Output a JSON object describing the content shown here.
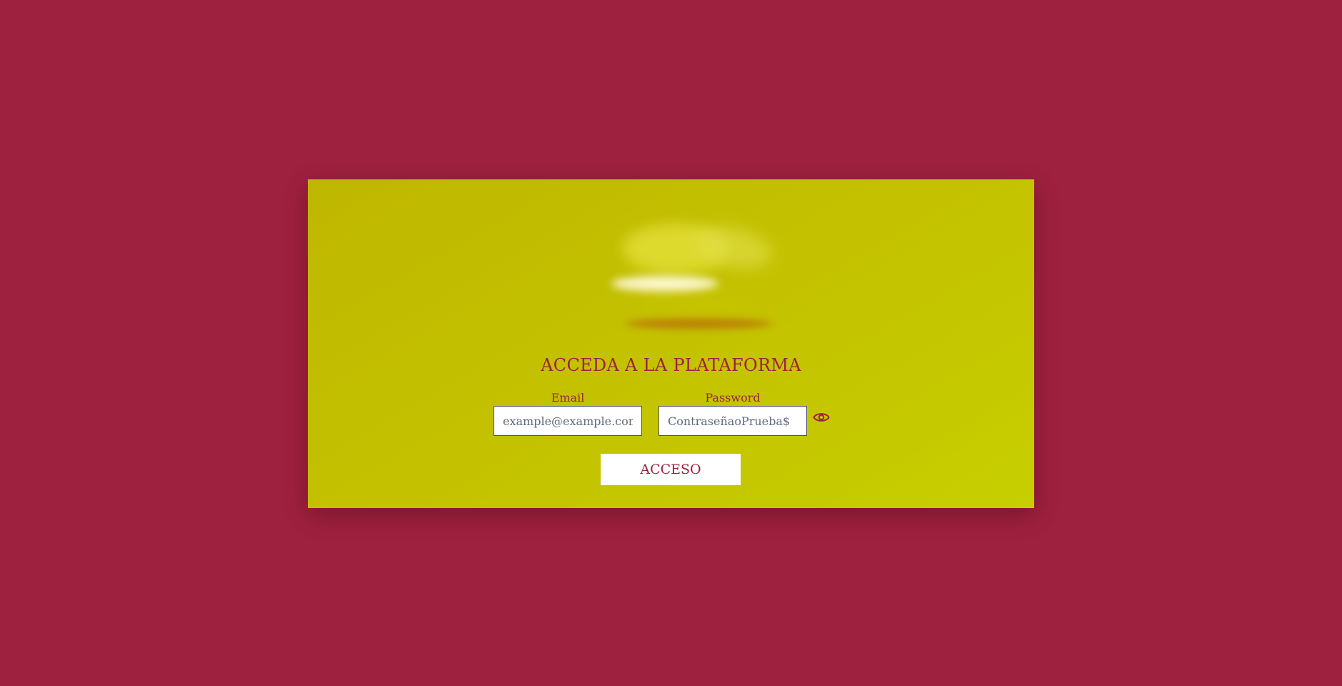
{
  "login": {
    "title": "ACCEDA A LA PLATAFORMA",
    "email_label": "Email",
    "email_placeholder": "example@example.com",
    "email_value": "",
    "password_label": "Password",
    "password_placeholder": "ContraseñaoPrueba$",
    "password_value": "",
    "toggle_icon": "eye-icon",
    "submit_label": "ACCESO"
  },
  "colors": {
    "background": "#9e213f",
    "card": "#c4c300",
    "accent": "#9e213f",
    "button_bg": "#ffffff"
  }
}
